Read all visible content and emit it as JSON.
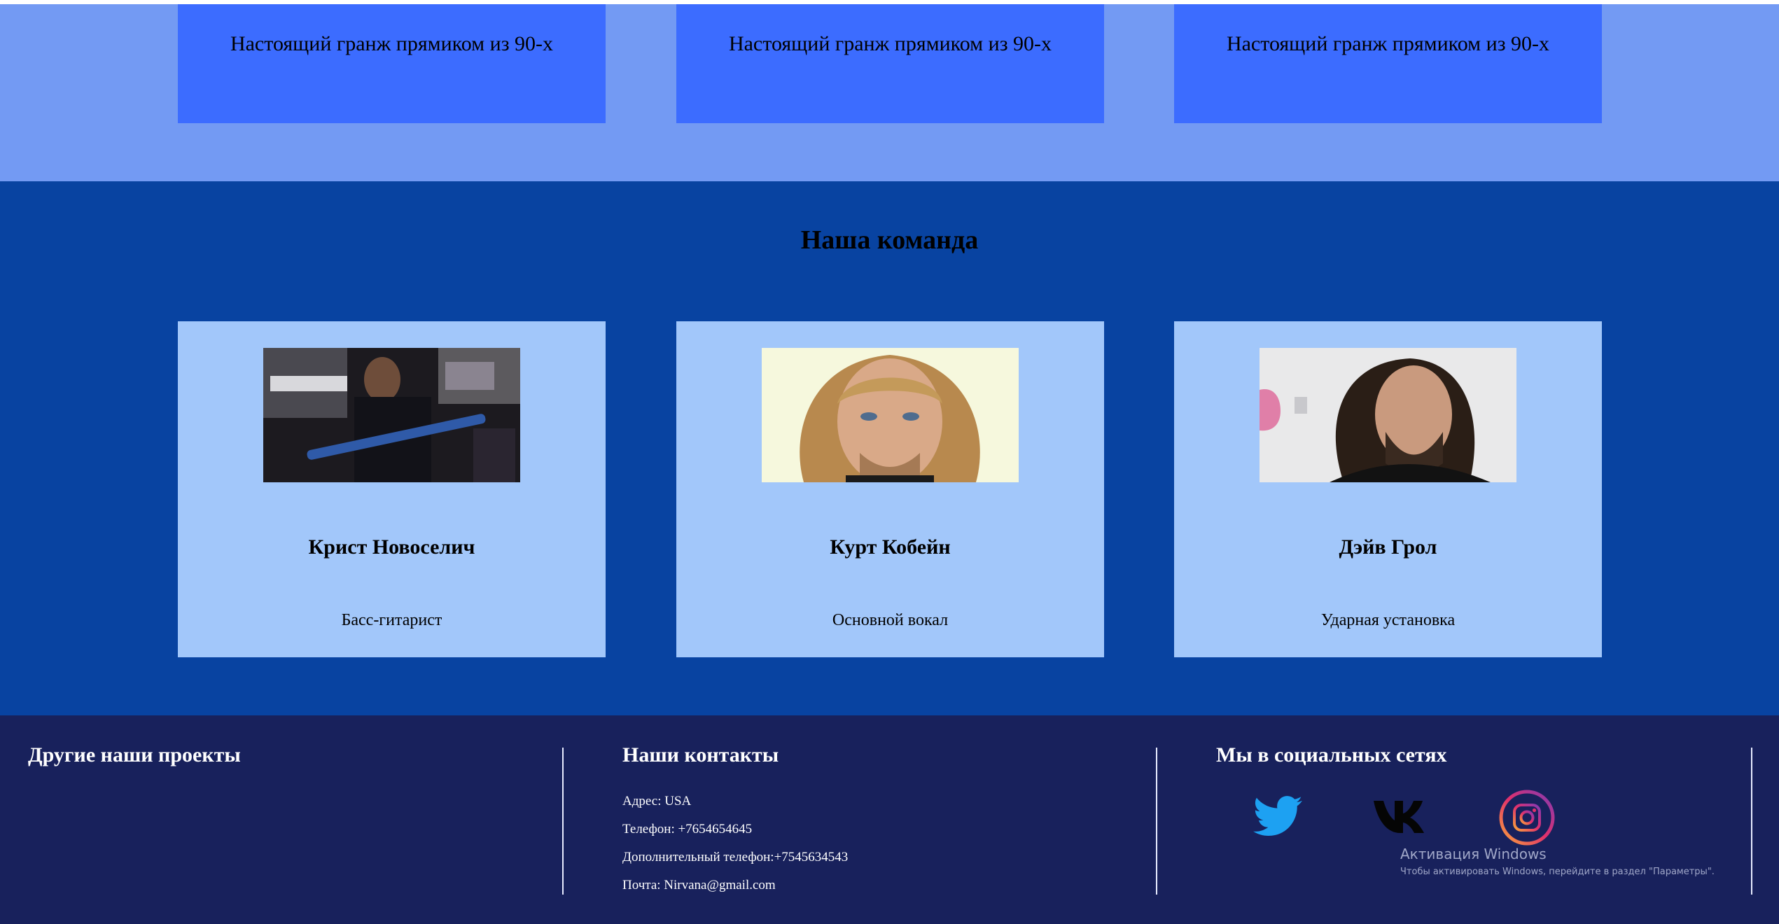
{
  "albums": [
    {
      "caption": "Настоящий гранж прямиком из 90-х"
    },
    {
      "caption": "Настоящий гранж прямиком из 90-х"
    },
    {
      "caption": "Настоящий гранж прямиком из 90-х"
    }
  ],
  "team": {
    "title": "Наша команда",
    "members": [
      {
        "name": "Крист Новоселич",
        "role": "Басс-гитарист"
      },
      {
        "name": "Курт Кобейн",
        "role": "Основной вокал"
      },
      {
        "name": "Дэйв Грол",
        "role": "Ударная установка"
      }
    ]
  },
  "footer": {
    "projects": {
      "heading": "Другие наши проекты"
    },
    "contacts": {
      "heading": "Наши контакты",
      "address": "Адрес: USA",
      "phone": "Телефон: +7654654645",
      "extra_phone": "Дополнительный телефон:+7545634543",
      "email": "Почта: Nirvana@gmail.com"
    },
    "social": {
      "heading": "Мы в социальных сетях",
      "icons": [
        "twitter-icon",
        "vk-icon",
        "instagram-icon"
      ]
    }
  },
  "windows_activation": {
    "title": "Активация Windows",
    "subtitle": "Чтобы активировать Windows, перейдите в раздел \"Параметры\"."
  },
  "colors": {
    "albums_bg": "#739af3",
    "album_card": "#3c6cff",
    "team_bg": "#0843a1",
    "member_card": "#a2c7fa",
    "footer_bg": "#18215c",
    "twitter": "#1da1f2"
  }
}
